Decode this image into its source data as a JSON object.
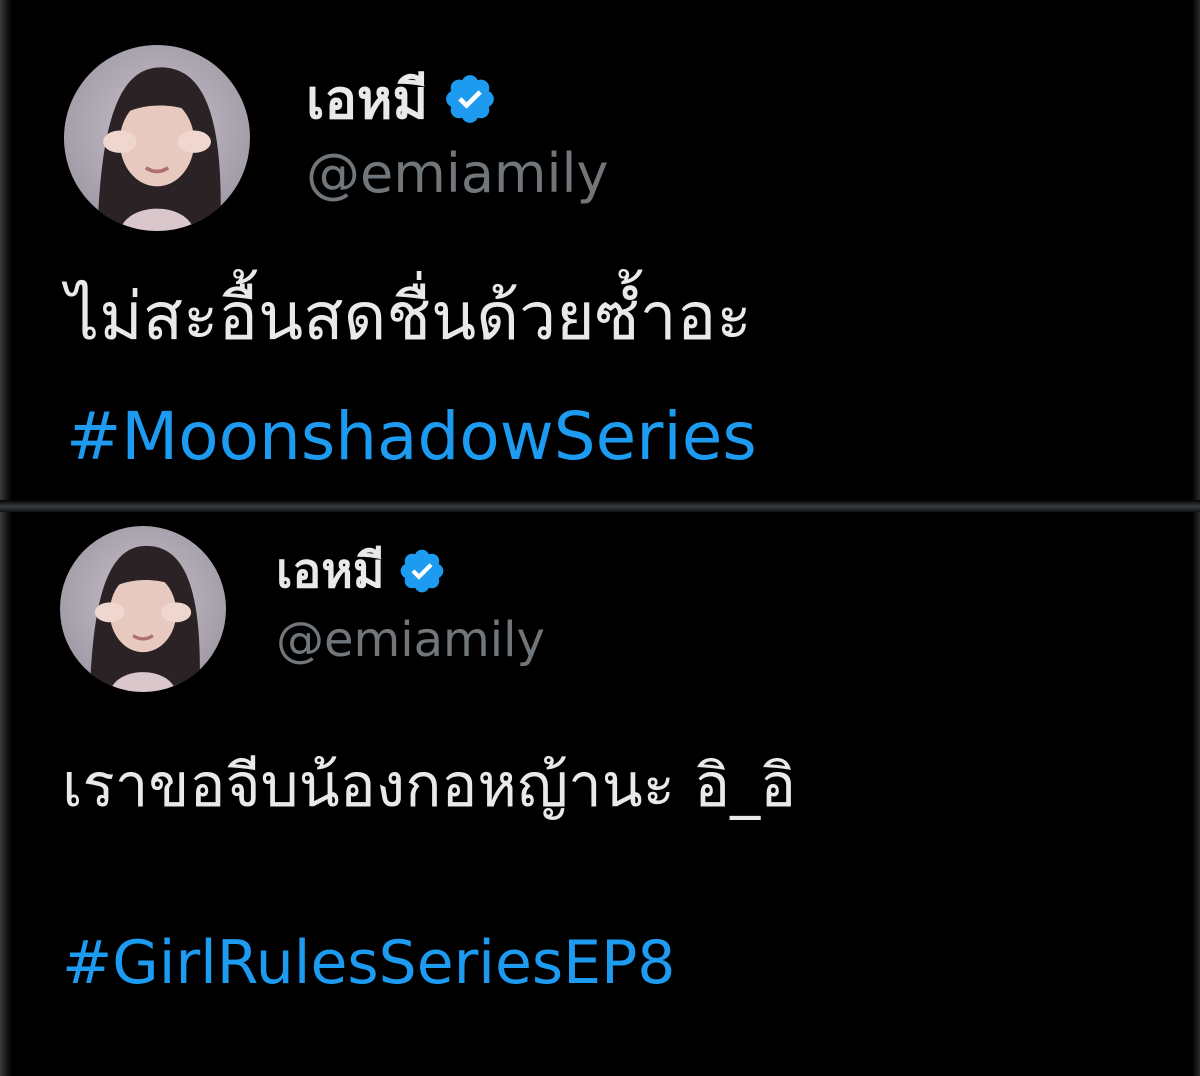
{
  "posts": [
    {
      "display_name": "เอหมี",
      "verified_icon": "verified-badge-icon",
      "handle": "@emiamily",
      "text": "ไม่สะอื้นสดชื่นด้วยซ้ำอะ",
      "hashtag": "#MoonshadowSeries"
    },
    {
      "display_name": "เอหมี",
      "verified_icon": "verified-badge-icon",
      "handle": "@emiamily",
      "text": "เราขอจีบน้องกอหญ้านะ อิ_อิ",
      "hashtag": "#GirlRulesSeriesEP8"
    }
  ],
  "colors": {
    "background": "#000000",
    "text": "#e7e9ea",
    "handle": "#71767b",
    "link": "#1d9bf0",
    "verified": "#1d9bf0"
  }
}
